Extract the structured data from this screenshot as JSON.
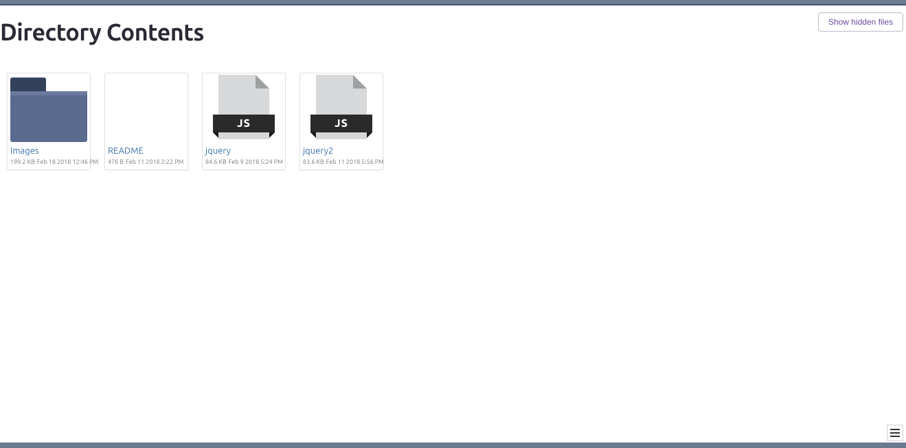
{
  "header": {
    "title": "Directory Contents",
    "show_hidden_label": "Show hidden files"
  },
  "files": [
    {
      "name": "Images",
      "type": "folder",
      "size": "199.2 KB",
      "date": "Feb 18 2018 12:46 PM"
    },
    {
      "name": "README",
      "type": "file",
      "size": "476 B",
      "date": "Feb 11 2018 2:22 PM"
    },
    {
      "name": "jquery",
      "type": "js",
      "size": "84.6 KB",
      "date": "Feb 9 2018 5:24 PM"
    },
    {
      "name": "jquery2",
      "type": "js",
      "size": "83.6 KB",
      "date": "Feb 11 2018 5:56 PM"
    }
  ],
  "js_badge": "JS"
}
